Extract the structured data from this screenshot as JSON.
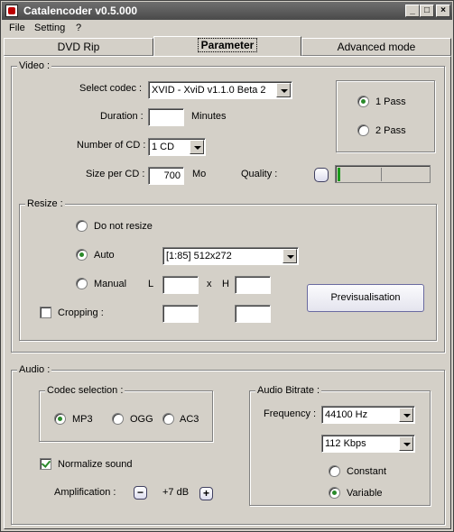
{
  "window": {
    "title": "Catalencoder v0.5.000",
    "minimize": "_",
    "maximize": "□",
    "close": "×"
  },
  "menu": {
    "file": "File",
    "setting": "Setting",
    "help": "?"
  },
  "tabs": {
    "dvd_rip": "DVD Rip",
    "parameter": "Parameter",
    "advanced": "Advanced mode",
    "active": "Parameter"
  },
  "video": {
    "title": "Video :",
    "codec_label": "Select codec :",
    "codec_value": "XVID - XviD v1.1.0 Beta 2",
    "duration_label": "Duration :",
    "duration_value": "",
    "duration_unit": "Minutes",
    "num_cd_label": "Number of CD :",
    "num_cd_value": "1 CD",
    "size_label": "Size per CD :",
    "size_value": "700",
    "size_unit": "Mo",
    "quality_label": "Quality :",
    "quality_level": 0.02,
    "pass1": "1 Pass",
    "pass2": "2 Pass",
    "pass_selected": "1 Pass"
  },
  "resize": {
    "title": "Resize :",
    "no_resize": "Do not resize",
    "auto": "Auto",
    "manual": "Manual",
    "selected": "Auto",
    "auto_value": "[1:85] 512x272",
    "l_label": "L",
    "x_label": "x",
    "h_label": "H",
    "l_value": "",
    "h_value": "",
    "cropping": "Cropping :",
    "cropping_checked": false,
    "preview_button": "Previsualisation"
  },
  "audio": {
    "title": "Audio :",
    "codec_title": "Codec selection :",
    "mp3": "MP3",
    "ogg": "OGG",
    "ac3": "AC3",
    "codec_selected": "MP3",
    "normalize": "Normalize sound",
    "normalize_checked": true,
    "amp_label": "Amplification :",
    "amp_minus": "−",
    "amp_value": "+7 dB",
    "amp_plus": "+",
    "bitrate_title": "Audio Bitrate :",
    "freq_label": "Frequency :",
    "freq_value": "44100 Hz",
    "bitrate_value": "112 Kbps",
    "constant": "Constant",
    "variable": "Variable",
    "mode_selected": "Variable"
  }
}
